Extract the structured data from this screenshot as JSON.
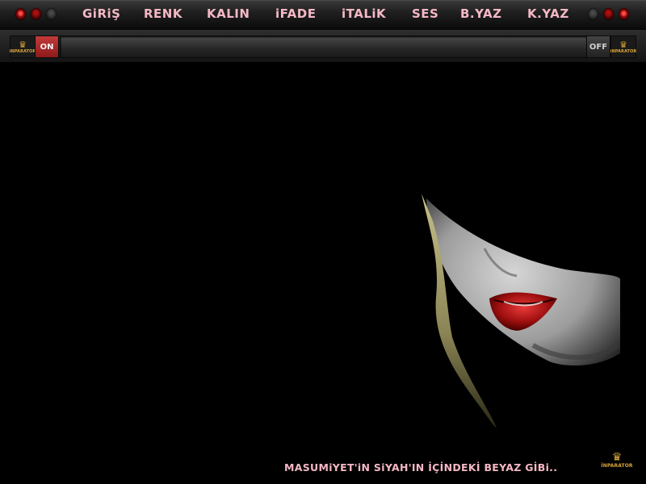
{
  "menu": {
    "items": [
      {
        "label": "GiRiŞ"
      },
      {
        "label": "RENK"
      },
      {
        "label": "KALIN"
      },
      {
        "label": "iFADE"
      },
      {
        "label": "iTALiK"
      },
      {
        "label": "SES"
      },
      {
        "label": "B.YAZ"
      },
      {
        "label": "K.YAZ"
      }
    ]
  },
  "toolbar": {
    "logo_left_text": "iNPARATOR",
    "logo_right_text": "iNPARATOR",
    "on_label": "ON",
    "off_label": "OFF",
    "logo_icon": "crown-icon"
  },
  "footer": {
    "caption": "MASUMiYET'iN SiYAH'IN İÇİNDEKİ BEYAZ GİBi..",
    "logo_text": "İNPARATOR"
  },
  "colors": {
    "menu_text": "#f5b8c6",
    "accent_red": "#a51c1c",
    "logo_gold": "#d9a63a",
    "background": "#000000"
  }
}
